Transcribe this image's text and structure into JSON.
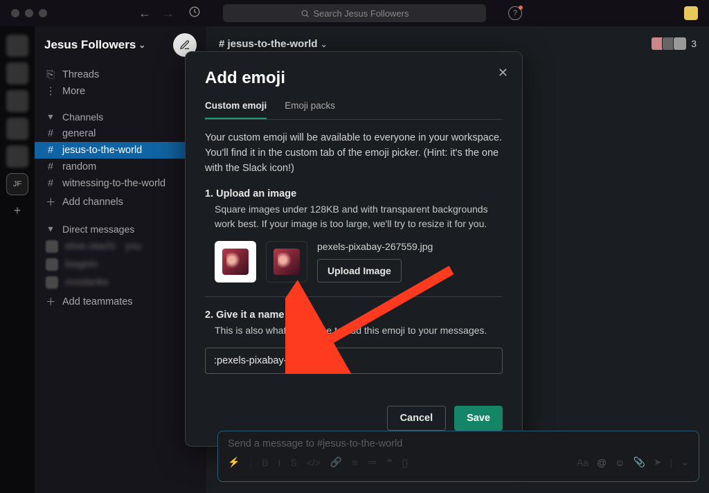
{
  "topbar": {
    "search_placeholder": "Search Jesus Followers"
  },
  "workspace": {
    "name": "Jesus Followers"
  },
  "sidebar": {
    "threads": "Threads",
    "more": "More",
    "channels_header": "Channels",
    "channels": [
      {
        "name": "general"
      },
      {
        "name": "jesus-to-the-world",
        "active": true
      },
      {
        "name": "random"
      },
      {
        "name": "witnessing-to-the-world"
      }
    ],
    "add_channels": "Add channels",
    "dm_header": "Direct messages",
    "dms": [
      {
        "name": "elsie.otachi",
        "suffix": "you"
      },
      {
        "name": "biagelo"
      },
      {
        "name": "moolanke"
      }
    ],
    "add_teammates": "Add teammates"
  },
  "channel": {
    "title": "# jesus-to-the-world",
    "member_count": "3"
  },
  "modal": {
    "title": "Add emoji",
    "tab_custom": "Custom emoji",
    "tab_packs": "Emoji packs",
    "intro": "Your custom emoji will be available to everyone in your workspace. You'll find it in the custom tab of the emoji picker. (Hint: it's the one with the Slack icon!)",
    "step1_title": "1. Upload an image",
    "step1_desc": "Square images under 128KB and with transparent backgrounds work best. If your image is too large, we'll try to resize it for you.",
    "filename": "pexels-pixabay-267559.jpg",
    "upload_btn": "Upload Image",
    "step2_title": "2. Give it a name",
    "step2_desc": "This is also what you'll type to add this emoji to your messages.",
    "name_value": ":pexels-pixabay-267559:",
    "cancel": "Cancel",
    "save": "Save"
  },
  "composer": {
    "placeholder": "Send a message to #jesus-to-the-world"
  }
}
